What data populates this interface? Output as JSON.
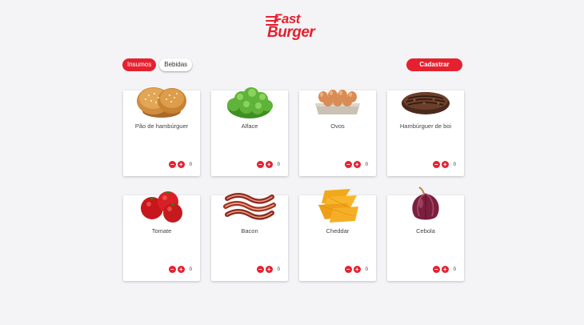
{
  "brand": {
    "line1": "Fast",
    "line2": "Burger"
  },
  "tabs": [
    {
      "label": "Insumos",
      "active": true
    },
    {
      "label": "Bebidas",
      "active": false
    }
  ],
  "actions": {
    "register_label": "Cadastrar"
  },
  "controls": {
    "minus": "−",
    "plus": "+"
  },
  "items": [
    {
      "name": "Pão de hambúrguer",
      "qty": "0",
      "icon": "bun-icon"
    },
    {
      "name": "Alface",
      "qty": "0",
      "icon": "lettuce-icon"
    },
    {
      "name": "Ovos",
      "qty": "0",
      "icon": "eggs-icon"
    },
    {
      "name": "Hambúrguer de boi",
      "qty": "0",
      "icon": "patty-icon"
    },
    {
      "name": "Tomate",
      "qty": "0",
      "icon": "tomato-icon"
    },
    {
      "name": "Bacon",
      "qty": "0",
      "icon": "bacon-icon"
    },
    {
      "name": "Cheddar",
      "qty": "0",
      "icon": "cheddar-icon"
    },
    {
      "name": "Cebola",
      "qty": "0",
      "icon": "onion-icon"
    }
  ],
  "colors": {
    "accent": "#e5212f",
    "background": "#f4f4f6"
  }
}
